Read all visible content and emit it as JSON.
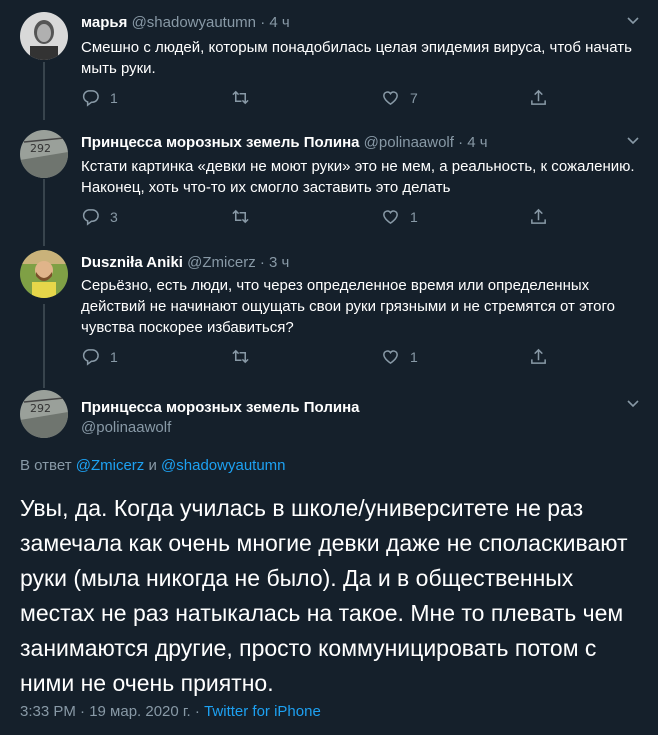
{
  "tweets": [
    {
      "name": "марья",
      "handle": "@shadowyautumn",
      "time": "4 ч",
      "text": "Смешно с людей, которым понадобилась целая эпидемия вируса, чтоб начать мыть руки.",
      "replies": "1",
      "retweets": "",
      "likes": "7"
    },
    {
      "name": "Принцесса морозных земель Полина",
      "handle": "@polinaawolf",
      "time": "4 ч",
      "text": "Кстати картинка «девки не моют руки» это не мем, а реальность, к сожалению. Наконец, хоть что-то их смогло заставить это делать",
      "replies": "3",
      "retweets": "",
      "likes": "1"
    },
    {
      "name": "Duszniła Aniki",
      "handle": "@Zmicerz",
      "time": "3 ч",
      "text": "Серьёзно, есть люди, что через определенное время или определенных действий не начинают ощущать свои руки грязными и не стремятся от этого чувства поскорее избавиться?",
      "replies": "1",
      "retweets": "",
      "likes": "1"
    }
  ],
  "main_tweet": {
    "name": "Принцесса морозных земель Полина",
    "handle": "@polinaawolf",
    "reply_prefix": "В ответ",
    "reply_to_1": "@Zmicerz",
    "reply_and": "и",
    "reply_to_2": "@shadowyautumn",
    "text": "Увы, да. Когда училась в школе/университете не раз замечала как очень многие девки даже не споласкивают руки (мыла никогда не было). Да и в общественных местах не раз натыкалась на такое. Мне то плевать чем занимаются другие, просто коммуницировать потом с ними не очень приятно.",
    "timestamp": "3:33 PM · 19 мар. 2020 г. ·",
    "client": "Twitter for iPhone"
  },
  "colors": {
    "background": "#15202b",
    "muted": "#8899a6",
    "link": "#1da1f2",
    "divider": "#38444d"
  },
  "icons": [
    "reply-icon",
    "retweet-icon",
    "like-icon",
    "share-icon",
    "chevron-down-icon"
  ]
}
